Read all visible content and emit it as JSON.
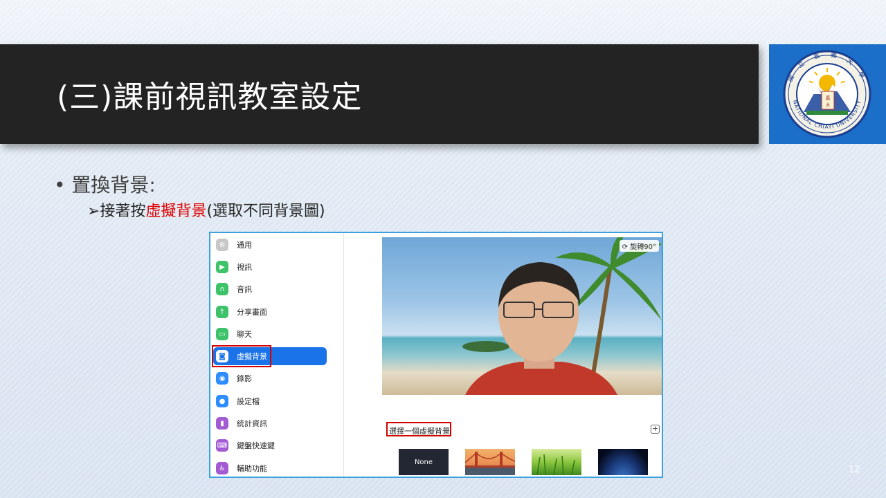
{
  "slide": {
    "title": "(三)課前視訊教室設定",
    "bullet1": "• 置換背景:",
    "bullet2_arrow": "➢",
    "bullet2_before": "接著按",
    "bullet2_highlight": "虛擬背景",
    "bullet2_after": "(選取不同背景圖)",
    "page_number": "12",
    "colors": {
      "title_bg": "#232323",
      "highlight": "#e00000",
      "logo_bg": "#1b6fc8"
    }
  },
  "logo": {
    "icon": "national-chiayi-university-seal",
    "ring_text": "NATIONAL CHIAYI UNIVERSITY"
  },
  "zoom": {
    "sidebar": [
      {
        "label": "通用",
        "icon": "gear-icon",
        "color": "#c7c7c7"
      },
      {
        "label": "視訊",
        "icon": "video-icon",
        "color": "#3ec36b"
      },
      {
        "label": "音訊",
        "icon": "headphone-icon",
        "color": "#3ec36b"
      },
      {
        "label": "分享畫面",
        "icon": "share-screen-icon",
        "color": "#3ec36b"
      },
      {
        "label": "聊天",
        "icon": "chat-icon",
        "color": "#3ec36b"
      },
      {
        "label": "虛擬背景",
        "icon": "virtual-background-icon",
        "color": "#ffffff"
      },
      {
        "label": "錄影",
        "icon": "record-icon",
        "color": "#2d8cff"
      },
      {
        "label": "設定檔",
        "icon": "profile-icon",
        "color": "#2d8cff"
      },
      {
        "label": "統計資訊",
        "icon": "statistics-icon",
        "color": "#a35bd3"
      },
      {
        "label": "鍵盤快速鍵",
        "icon": "keyboard-icon",
        "color": "#a35bd3"
      },
      {
        "label": "輔助功能",
        "icon": "accessibility-icon",
        "color": "#a35bd3"
      }
    ],
    "active_index": 5,
    "rotate_label": "旋轉90°",
    "choose_label": "選擇一個虛擬背景",
    "add_label": "+",
    "thumbnails": [
      {
        "label": "None"
      },
      {
        "label": ""
      },
      {
        "label": ""
      },
      {
        "label": ""
      }
    ]
  }
}
